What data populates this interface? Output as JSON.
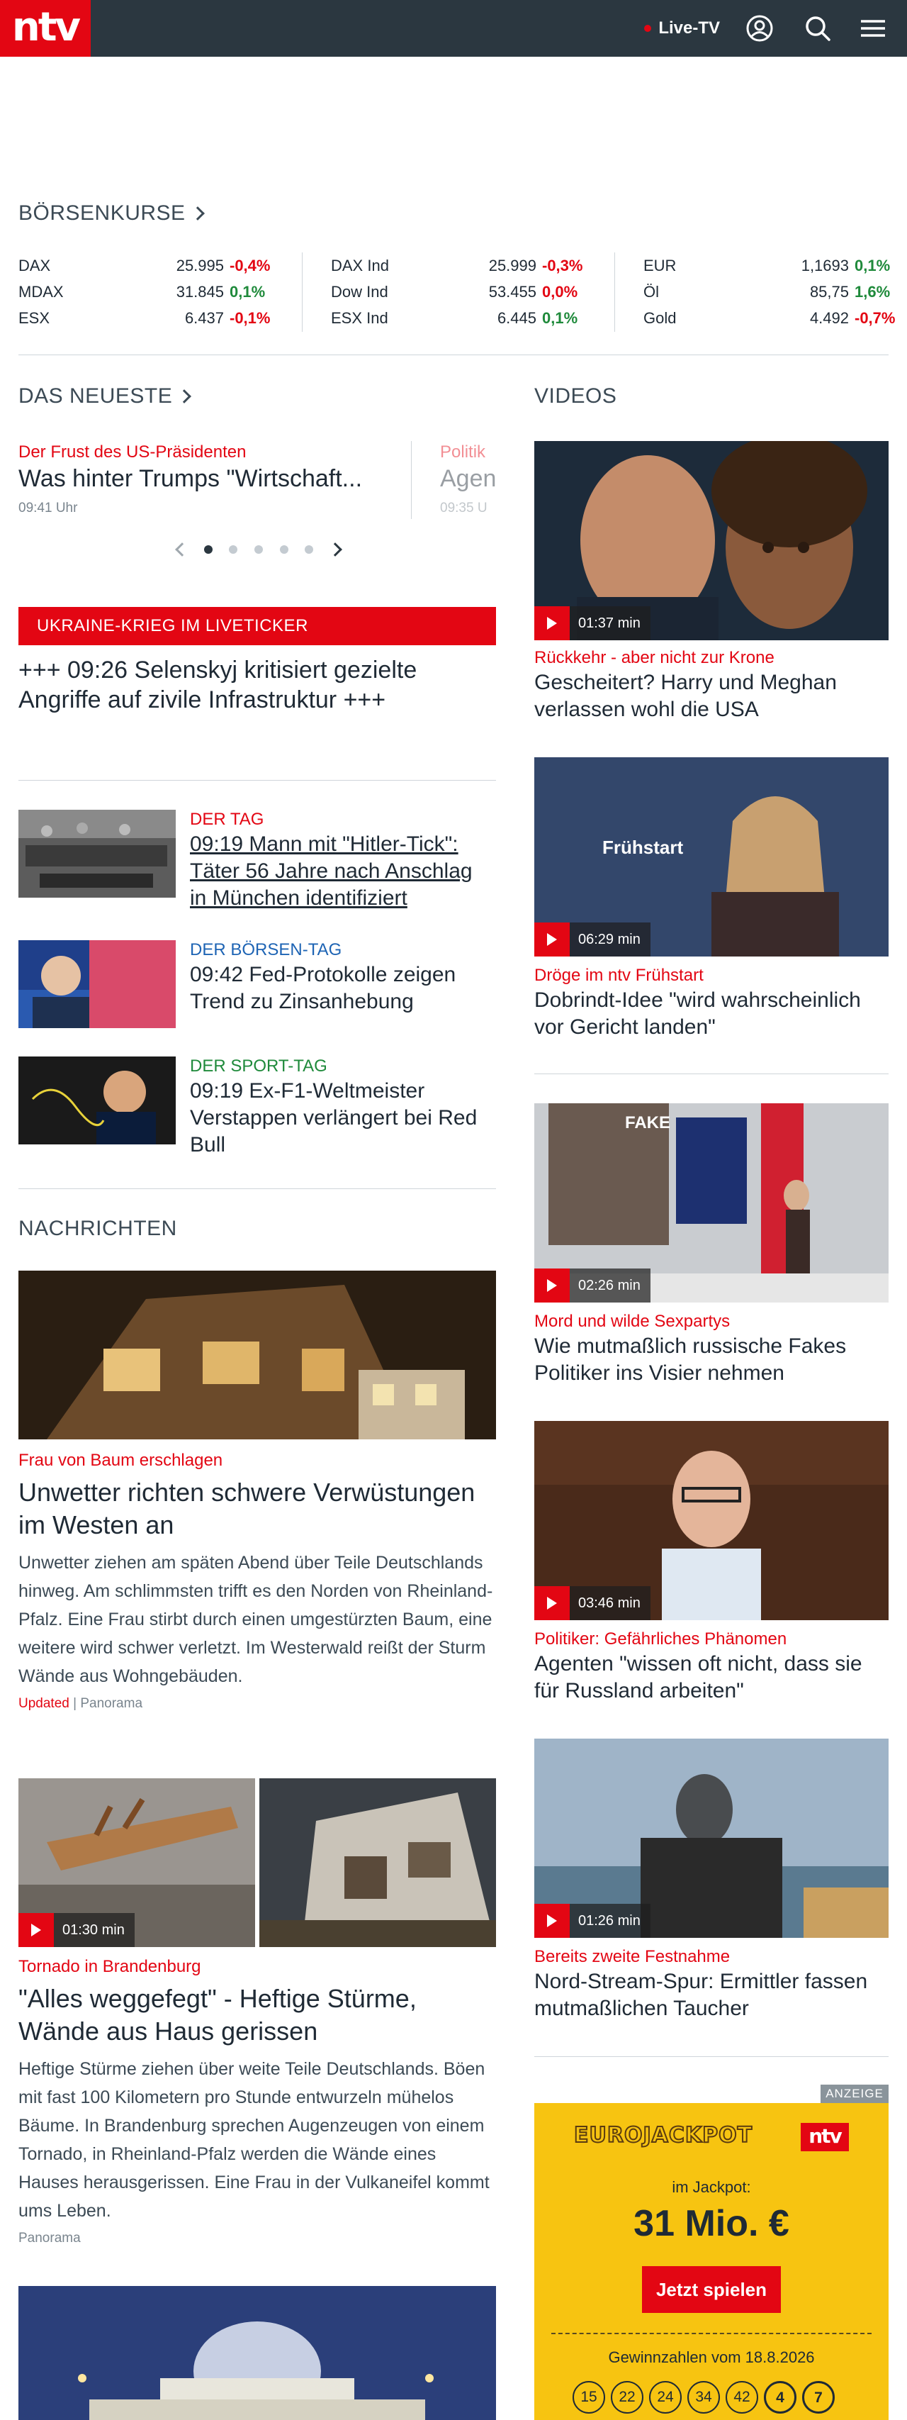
{
  "header": {
    "logo": "ntv",
    "live_tv": "Live-TV",
    "icons": [
      "user-icon",
      "search-icon",
      "menu-icon"
    ],
    "accent": "#e30613",
    "background": "#2b3740"
  },
  "boersenkurse": {
    "title": "BÖRSENKURSE",
    "columns": [
      [
        {
          "name": "DAX",
          "value": "25.995",
          "change": "-0,4%",
          "dir": "neg"
        },
        {
          "name": "MDAX",
          "value": "31.845",
          "change": "0,1%",
          "dir": "pos"
        },
        {
          "name": "ESX",
          "value": "6.437",
          "change": "-0,1%",
          "dir": "neg"
        }
      ],
      [
        {
          "name": "DAX Ind",
          "value": "25.999",
          "change": "-0,3%",
          "dir": "neg"
        },
        {
          "name": "Dow Ind",
          "value": "53.455",
          "change": "0,0%",
          "dir": "neg"
        },
        {
          "name": "ESX Ind",
          "value": "6.445",
          "change": "0,1%",
          "dir": "pos"
        }
      ],
      [
        {
          "name": "EUR",
          "value": "1,1693",
          "change": "0,1%",
          "dir": "pos"
        },
        {
          "name": "Öl",
          "value": "85,75",
          "change": "1,6%",
          "dir": "pos"
        },
        {
          "name": "Gold",
          "value": "4.492",
          "change": "-0,7%",
          "dir": "neg"
        }
      ]
    ]
  },
  "neueste": {
    "title": "DAS NEUESTE",
    "slides": [
      {
        "kicker": "Der Frust des US-Präsidenten",
        "title": "Was hinter Trumps \"Wirtschaft...",
        "time": "09:41 Uhr"
      },
      {
        "kicker": "Politik",
        "title": "Agen",
        "time": "09:35 U"
      }
    ],
    "dots": 5,
    "active_dot": 0
  },
  "liveticker": {
    "label": "UKRAINE-KRIEG IM LIVETICKER",
    "headline": "+++ 09:26 Selenskyj kritisiert gezielte Angriffe auf zivile Infrastruktur +++"
  },
  "tagesticker": [
    {
      "kicker": "DER TAG",
      "color": "red",
      "title": "09:19 Mann mit \"Hitler-Tick\": Täter 56 Jahre nach Anschlag in München identifiziert"
    },
    {
      "kicker": "DER BÖRSEN-TAG",
      "color": "blue",
      "title": "09:42 Fed-Protokolle zeigen Trend zu Zinsanhebung"
    },
    {
      "kicker": "DER SPORT-TAG",
      "color": "green",
      "title": "09:19 Ex-F1-Weltmeister Verstappen verlängert bei Red Bull"
    }
  ],
  "nachrichten": {
    "title": "NACHRICHTEN",
    "articles": [
      {
        "kicker": "Frau von Baum erschlagen",
        "title": "Unwetter richten schwere Verwüstungen im Westen an",
        "text": "Unwetter ziehen am späten Abend über Teile Deutschlands hinweg. Am schlimmsten trifft es den Norden von Rheinland-Pfalz. Eine Frau stirbt durch einen umgestürzten Baum, eine weitere wird schwer verletzt. Im Westerwald reißt der Sturm Wände aus Wohngebäuden.",
        "updated": "Updated",
        "category": "Panorama"
      },
      {
        "duration": "01:30 min",
        "kicker": "Tornado in Brandenburg",
        "title": "\"Alles weggefegt\" - Heftige Stürme, Wände aus Haus gerissen",
        "text": "Heftige Stürme ziehen über weite Teile Deutschlands. Böen mit fast 100 Kilometern pro Stunde entwurzeln mühelos Bäume. In Brandenburg sprechen Augenzeugen von einem Tornado, in Rheinland-Pfalz werden die Wände eines Hauses herausgerissen. Eine Frau in der Vulkaneifel kommt ums Leben.",
        "category": "Panorama"
      }
    ]
  },
  "videos": {
    "title": "VIDEOS",
    "items": [
      {
        "duration": "01:37 min",
        "kicker": "Rückkehr - aber nicht zur Krone",
        "title": "Gescheitert? Harry und Meghan verlassen wohl die USA"
      },
      {
        "duration": "06:29 min",
        "kicker": "Dröge im ntv Frühstart",
        "title": "Dobrindt-Idee \"wird wahrscheinlich vor Gericht landen\"",
        "overlay": "Frühstart"
      },
      {
        "duration": "02:26 min",
        "kicker": "Mord und wilde Sexpartys",
        "title": "Wie mutmaßlich russische Fakes Politiker ins Visier nehmen",
        "overlay": "FAKE"
      },
      {
        "duration": "03:46 min",
        "kicker": "Politiker: Gefährliches Phänomen",
        "title": "Agenten \"wissen oft nicht, dass sie für Russland arbeiten\""
      },
      {
        "duration": "01:26 min",
        "kicker": "Bereits zweite Festnahme",
        "title": "Nord-Stream-Spur: Ermittler fassen mutmaßlichen Taucher"
      }
    ]
  },
  "ad": {
    "anzeige": "ANZEIGE",
    "logo_text": "EUROJACKPOT",
    "ntv": "ntv",
    "label": "im Jackpot:",
    "amount": "31 Mio. €",
    "button": "Jetzt spielen",
    "draw_date": "Gewinnzahlen vom 18.8.2026",
    "numbers": [
      "15",
      "22",
      "24",
      "34",
      "42"
    ],
    "euro_numbers": [
      "4",
      "7"
    ]
  }
}
